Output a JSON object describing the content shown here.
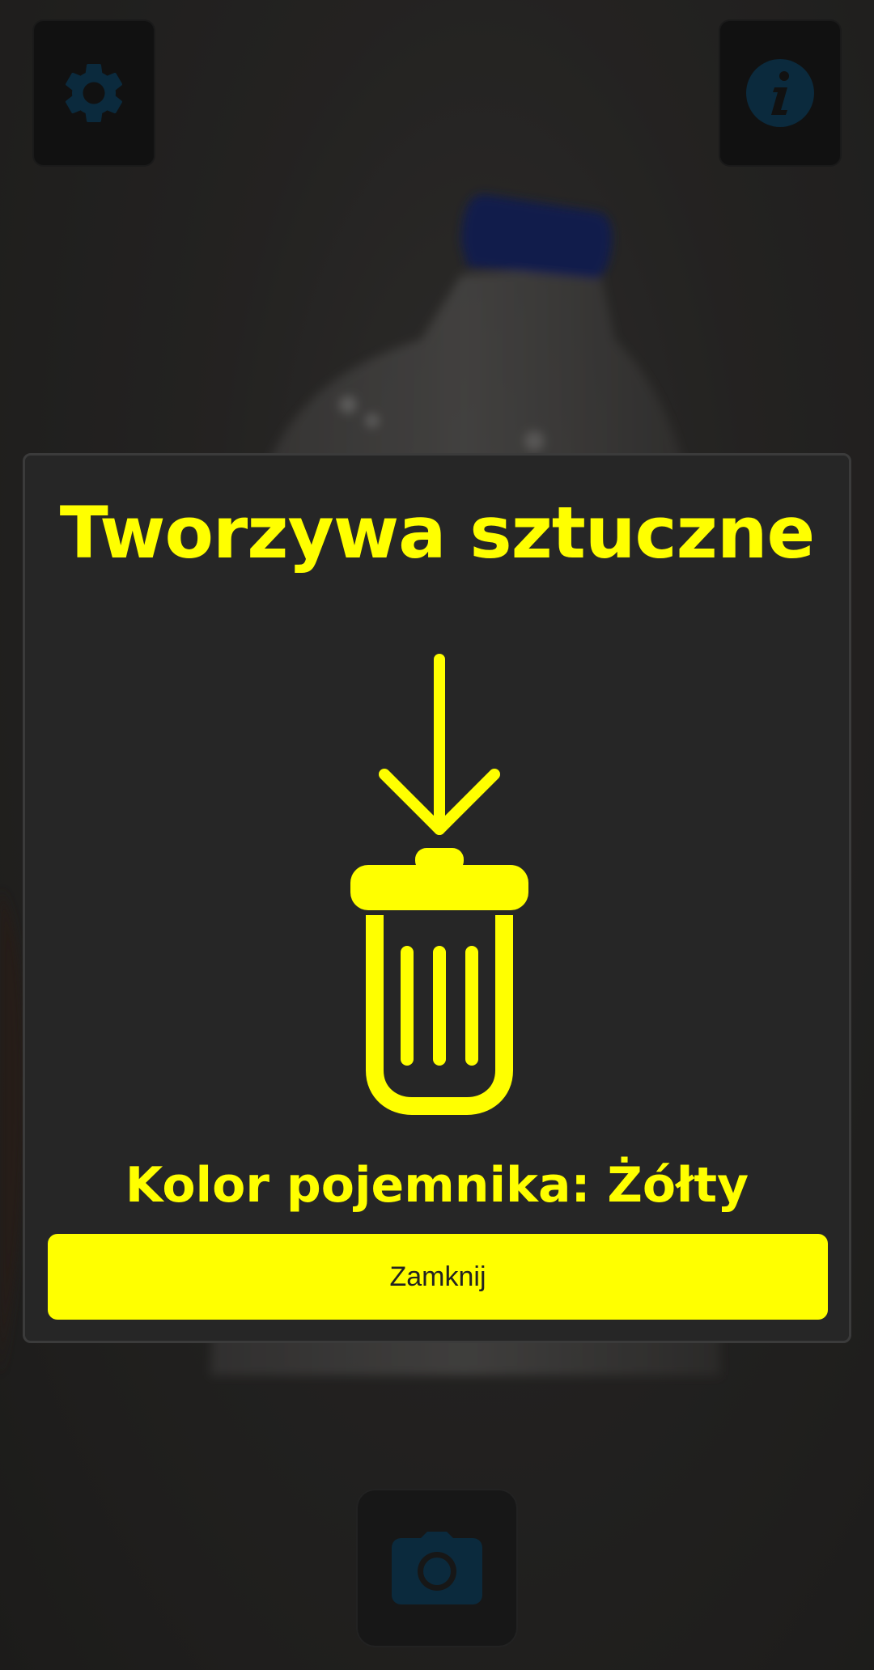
{
  "screen": {
    "background_scene": "plastic-bottle-camera-preview"
  },
  "toolbar": {
    "settings_icon": "gear-icon",
    "info_icon": "info-icon",
    "camera_icon": "camera-icon",
    "icon_color": "#0b2a3d"
  },
  "dialog": {
    "title": "Tworzywa sztuczne",
    "graphic_icon": "trash-bin-with-arrow-icon",
    "bin_color_text": "Kolor pojemnika: Żółty",
    "close_label": "Zamknij",
    "accent_color": "#ffff00",
    "background_color": "#262626"
  }
}
